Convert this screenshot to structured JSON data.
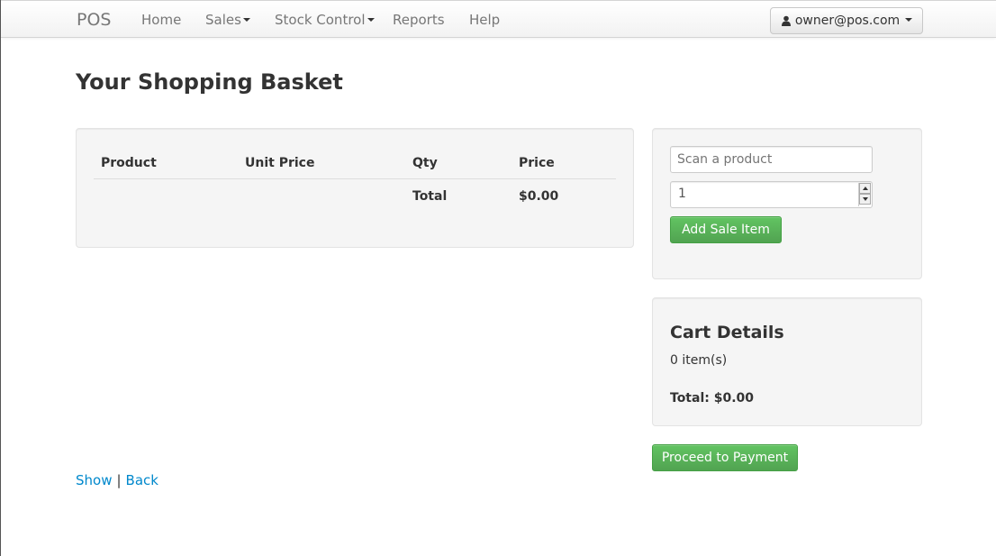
{
  "navbar": {
    "brand": "POS",
    "items": [
      {
        "label": "Home",
        "dropdown": false
      },
      {
        "label": "Sales",
        "dropdown": true
      },
      {
        "label": "Stock Control",
        "dropdown": true
      },
      {
        "label": "Reports",
        "dropdown": false
      },
      {
        "label": "Help",
        "dropdown": false
      }
    ],
    "user": {
      "label": "owner@pos.com",
      "icon": "user-icon"
    }
  },
  "page": {
    "title": "Your Shopping Basket"
  },
  "basket": {
    "columns": [
      "Product",
      "Unit Price",
      "Qty",
      "Price"
    ],
    "rows": [],
    "total_label": "Total",
    "total_value": "$0.00"
  },
  "scan": {
    "placeholder": "Scan a product",
    "quantity": "1",
    "add_button": "Add Sale Item"
  },
  "cart": {
    "title": "Cart Details",
    "items": "0 item(s)",
    "total": "Total: $0.00"
  },
  "proceed_button": "Proceed to Payment",
  "footer_links": {
    "show": "Show",
    "separator": "|",
    "back": "Back"
  },
  "colors": {
    "success": "#5bb75b",
    "link": "#0088cc",
    "navbar_text": "#777777"
  }
}
